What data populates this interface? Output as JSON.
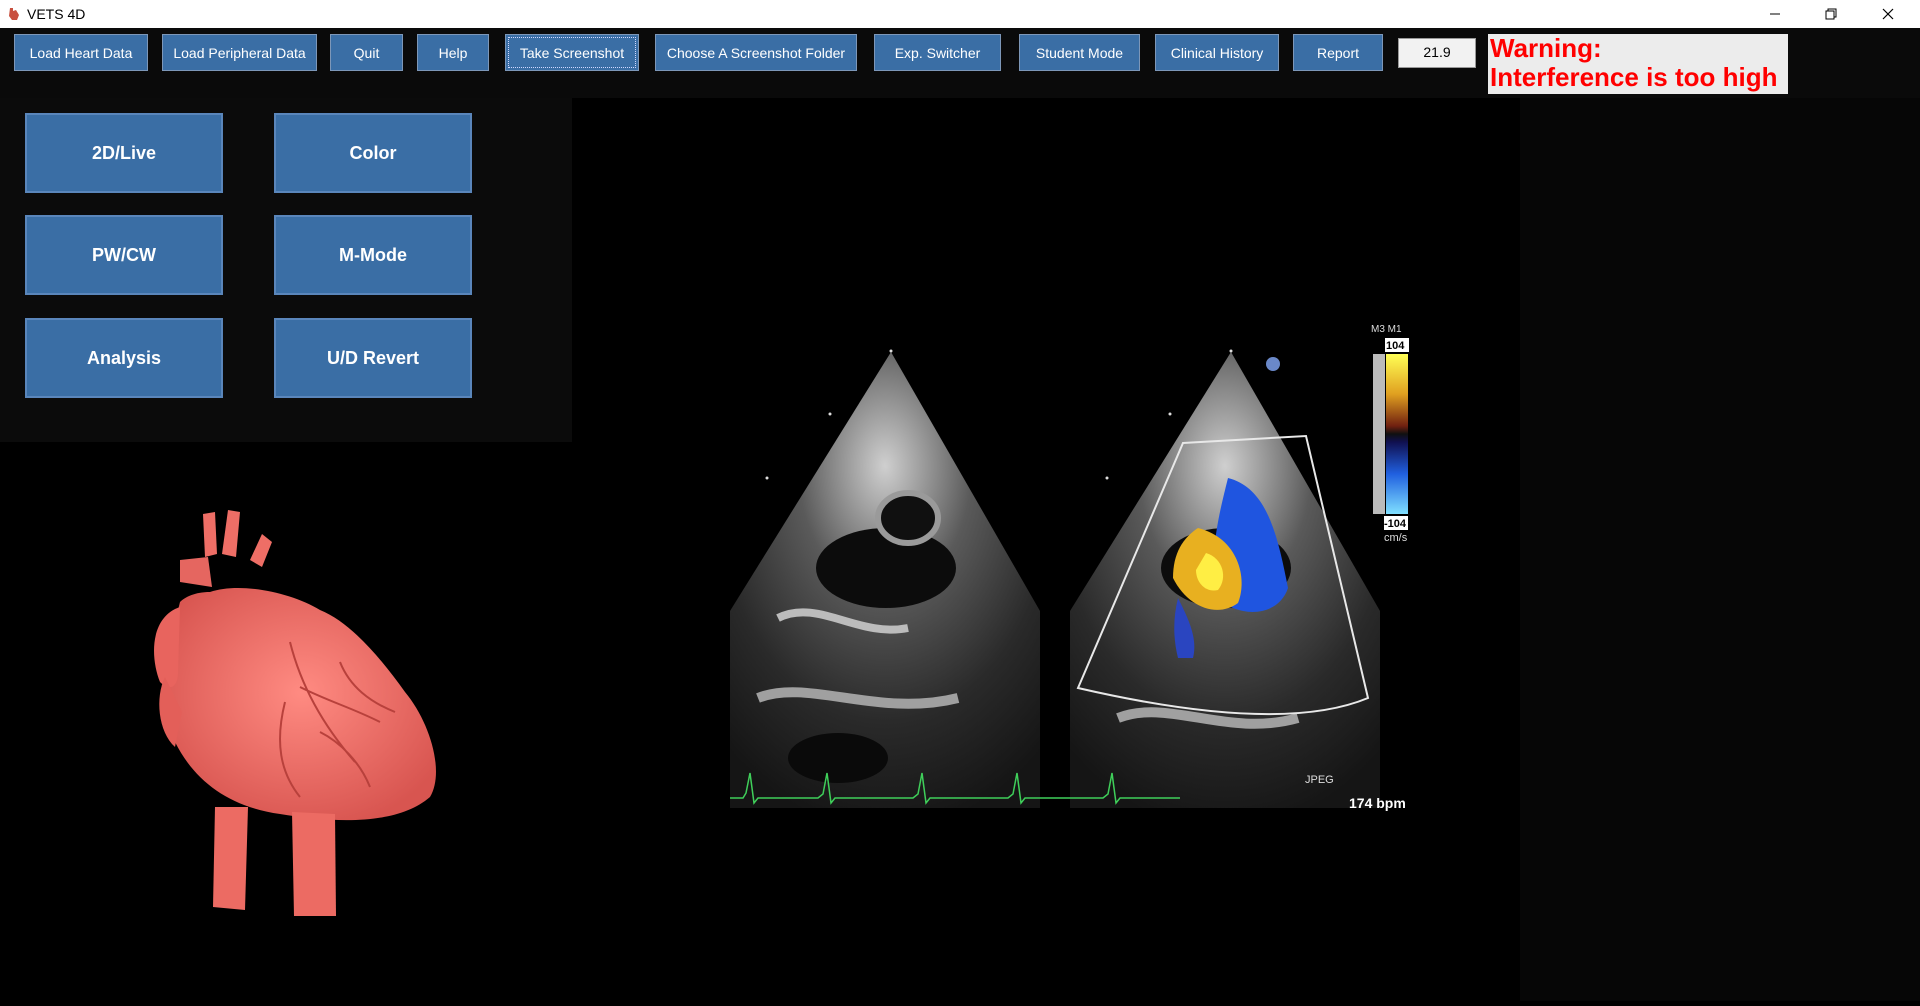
{
  "window": {
    "title": "VETS 4D"
  },
  "toolbar": {
    "buttons": [
      "Load Heart Data",
      "Load Peripheral Data",
      "Quit",
      "Help",
      "Take Screenshot",
      "Choose A Screenshot Folder",
      "Exp. Switcher",
      "Student Mode",
      "Clinical History",
      "Report"
    ],
    "value": "21.9",
    "warning_line1": "Warning:",
    "warning_line2": "Interference is too high"
  },
  "modes": {
    "btn1": "2D/Live",
    "btn2": "Color",
    "btn3": "PW/CW",
    "btn4": "M-Mode",
    "btn5": "Analysis",
    "btn6": "U/D Revert"
  },
  "ultrasound": {
    "scale_header": "M3 M1",
    "scale_max": "104",
    "scale_min": "-104",
    "scale_unit": "cm/s",
    "format_label": "JPEG",
    "heart_rate": "174 bpm"
  },
  "colors": {
    "button_blue": "#3a6ea5",
    "warning_red": "#ff0000",
    "heart_model": "#f0726a",
    "ecg_green": "#3fcf5a"
  },
  "icons": {
    "app": "heart-app-icon",
    "minimize": "minimize-icon",
    "restore": "restore-icon",
    "close": "close-icon"
  }
}
